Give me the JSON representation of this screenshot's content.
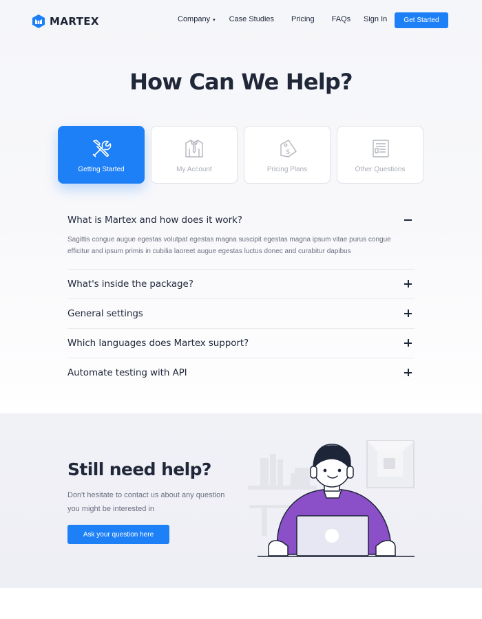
{
  "header": {
    "logo_text": "MARTEX",
    "nav": [
      "Company",
      "Case Studies",
      "Pricing",
      "FAQs"
    ],
    "signin_label": "Sign In",
    "cta_label": "Get Started"
  },
  "page_title": "How Can We Help?",
  "tabs": [
    {
      "label": "Getting Started",
      "icon": "tools-icon",
      "active": true
    },
    {
      "label": "My Account",
      "icon": "shirt-icon",
      "active": false
    },
    {
      "label": "Pricing Plans",
      "icon": "price-tag-icon",
      "active": false
    },
    {
      "label": "Other Questions",
      "icon": "document-icon",
      "active": false
    }
  ],
  "faq": [
    {
      "question": "What is Martex and how does it work?",
      "answer": "Sagittis congue augue egestas volutpat egestas magna suscipit egestas magna ipsum vitae purus congue efficitur and ipsum primis in cubilia laoreet augue egestas luctus donec and curabitur dapibus",
      "open": true
    },
    {
      "question": "What's inside the package?",
      "open": false
    },
    {
      "question": "General settings",
      "open": false
    },
    {
      "question": "Which languages does Martex support?",
      "open": false
    },
    {
      "question": "Automate testing with API",
      "open": false
    }
  ],
  "help": {
    "title": "Still need help?",
    "description": "Don't hesitate to contact us about any question you might be interested in",
    "button_label": "Ask your question here"
  },
  "colors": {
    "accent": "#1e80f7",
    "heading": "#1f2739",
    "muted": "#6b7080",
    "illustration_shirt": "#8b4fc7"
  }
}
